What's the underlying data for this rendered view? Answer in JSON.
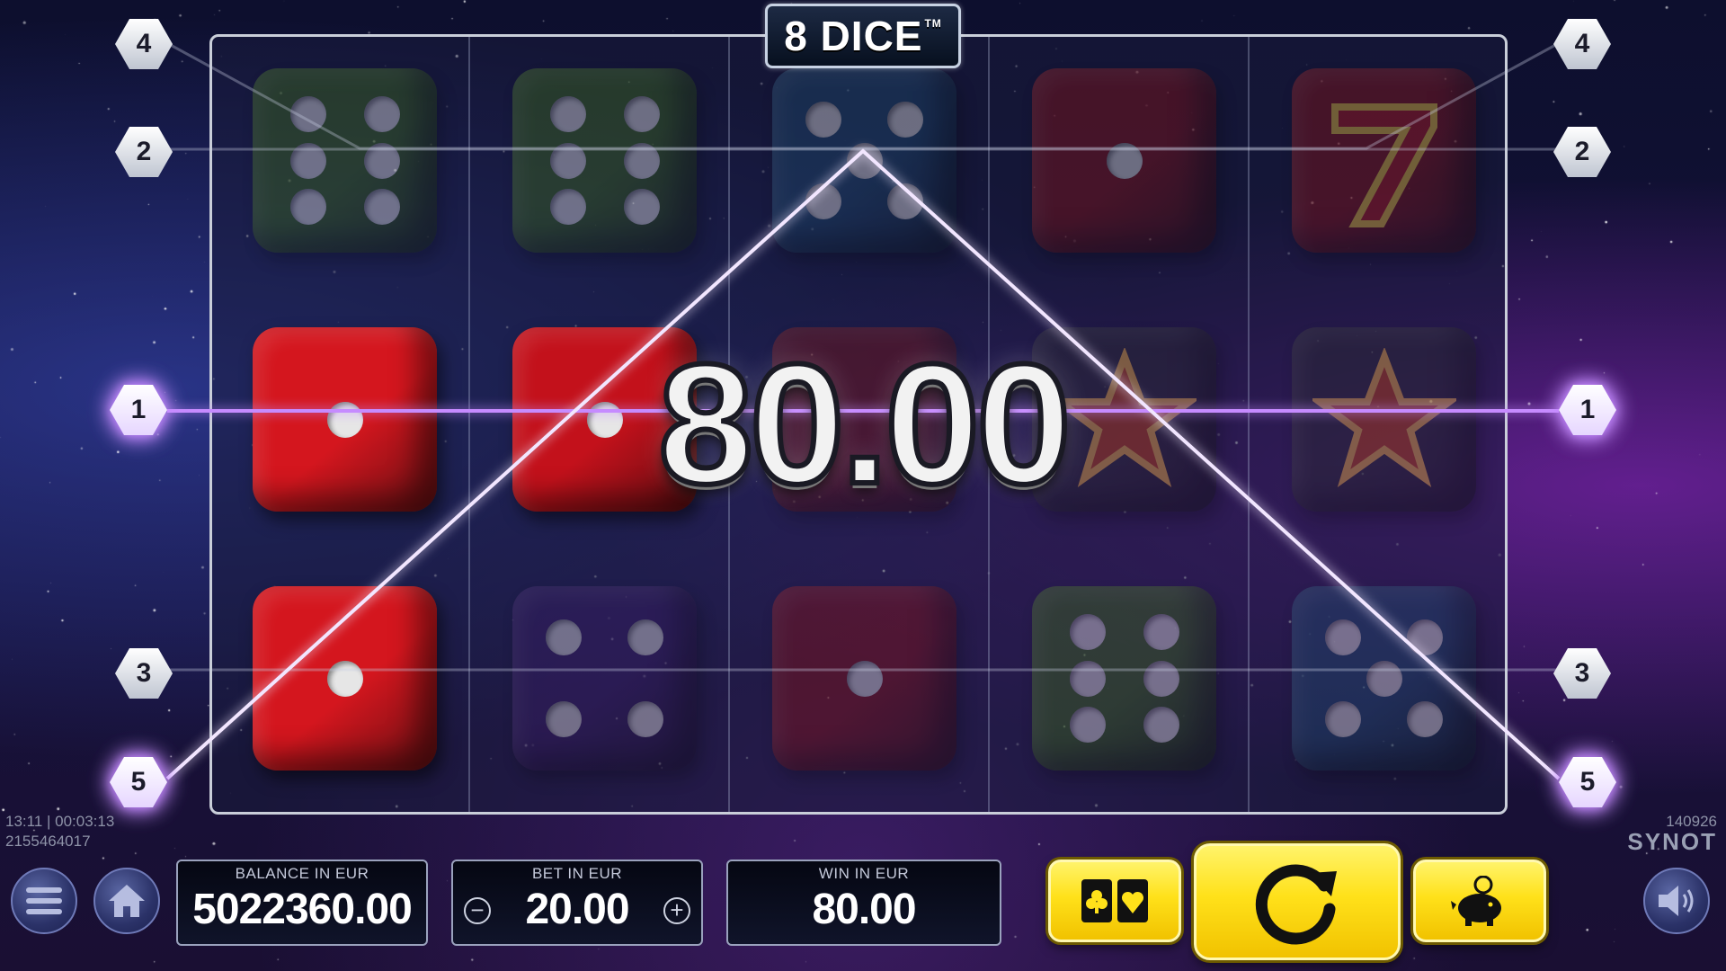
{
  "game": {
    "title": "8 DICE",
    "trademark": "TM"
  },
  "paylines_left": [
    "4",
    "2",
    "1",
    "3",
    "5"
  ],
  "paylines_right": [
    "4",
    "2",
    "1",
    "3",
    "5"
  ],
  "win_amount_display": "80.00",
  "reels": [
    [
      {
        "color": "#3e6b1a",
        "pips": 6
      },
      {
        "color": "#d4161e",
        "pips": 1
      },
      {
        "color": "#d4161e",
        "pips": 1
      }
    ],
    [
      {
        "color": "#3e6b1a",
        "pips": 6
      },
      {
        "color": "#c3111b",
        "pips": 1
      },
      {
        "color": "#3a1e66",
        "pips": 4
      }
    ],
    [
      {
        "color": "#1f4c70",
        "pips": 5
      },
      {
        "color": "#7a1210",
        "pips": 0
      },
      {
        "color": "#8a1216",
        "pips": 1
      }
    ],
    [
      {
        "color": "#8a1216",
        "pips": 1
      },
      {
        "color": "#2a2a30",
        "symbol": "star"
      },
      {
        "color": "#3e6b1a",
        "pips": 6
      }
    ],
    [
      {
        "color": "#8a1216",
        "symbol": "seven"
      },
      {
        "color": "#2a2a30",
        "symbol": "star"
      },
      {
        "color": "#1f4c70",
        "pips": 5
      }
    ]
  ],
  "session": {
    "clock": "13:11 | 00:03:13",
    "round_id": "2155464017"
  },
  "build": {
    "version": "140926",
    "brand": "SYNOT"
  },
  "balance": {
    "label": "BALANCE IN EUR",
    "value": "5022360.00"
  },
  "bet": {
    "label": "BET IN EUR",
    "value": "20.00",
    "minus": "−",
    "plus": "+"
  },
  "win": {
    "label": "WIN IN EUR",
    "value": "80.00"
  },
  "colors": {
    "accent_yellow": "#ffe11a",
    "payline_glow": "#b46bff",
    "panel_bg": "#050712"
  },
  "icons": {
    "menu": "menu-icon",
    "home": "home-icon",
    "gamble": "card-gamble-icon",
    "spin": "spin-refresh-icon",
    "autoplay": "piggy-bank-icon",
    "sound": "speaker-icon"
  }
}
